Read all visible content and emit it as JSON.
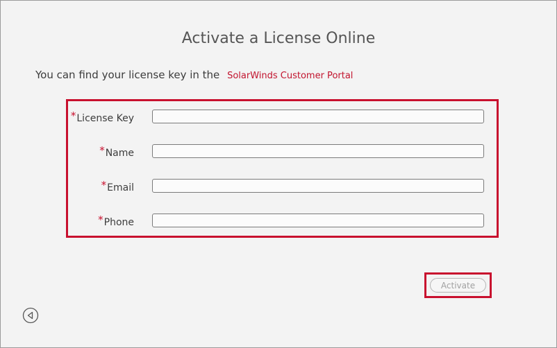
{
  "page": {
    "title": "Activate a License Online",
    "intro_text": "You can find your license key in the",
    "portal_link": "SolarWinds Customer Portal"
  },
  "form": {
    "required_marker": "*",
    "fields": [
      {
        "label": "License Key",
        "value": ""
      },
      {
        "label": "Name",
        "value": ""
      },
      {
        "label": "Email",
        "value": ""
      },
      {
        "label": "Phone",
        "value": ""
      }
    ]
  },
  "actions": {
    "activate_label": "Activate"
  },
  "icons": {
    "back": "back-arrow-icon"
  },
  "colors": {
    "highlight": "#c8102e",
    "link": "#c2142e"
  }
}
